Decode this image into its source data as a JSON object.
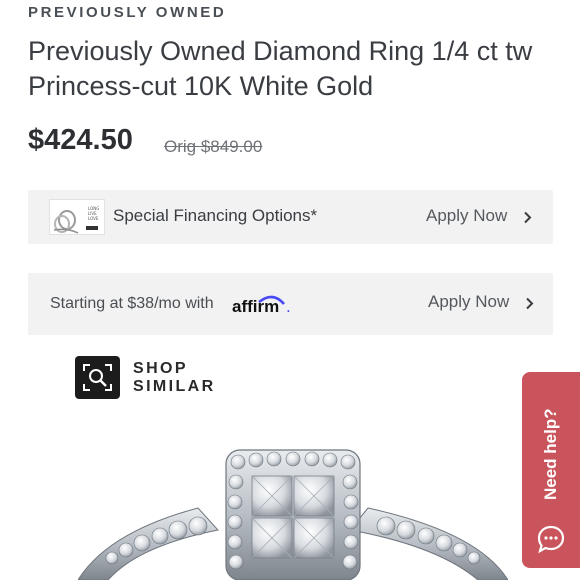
{
  "product": {
    "eyebrow": "PREVIOUSLY OWNED",
    "title": "Previously Owned Diamond Ring 1/4 ct tw Princess-cut 10K White Gold",
    "price": "$424.50",
    "original_price": "Orig $849.00"
  },
  "financing": {
    "thumbnail_text": [
      "LONG",
      "LIVE",
      "LOVE"
    ],
    "label": "Special Financing Options*",
    "cta": "Apply Now",
    "cta_icon": "chevron-right-icon"
  },
  "affirm": {
    "label": "Starting at $38/mo with",
    "logo_text": "affirm",
    "logo_suffix": ".",
    "cta": "Apply Now",
    "cta_icon": "chevron-right-icon"
  },
  "shop_similar": {
    "icon": "visual-search-icon",
    "line1": "SHOP",
    "line2": "SIMILAR"
  },
  "help": {
    "label": "Need help?",
    "icon": "chat-bubble-icon"
  },
  "colors": {
    "card_bg": "#f2f2f2",
    "help_tab": "#c9545b",
    "affirm_brand": "#4a4af4",
    "shop_icon_bg": "#1c1c1c"
  }
}
